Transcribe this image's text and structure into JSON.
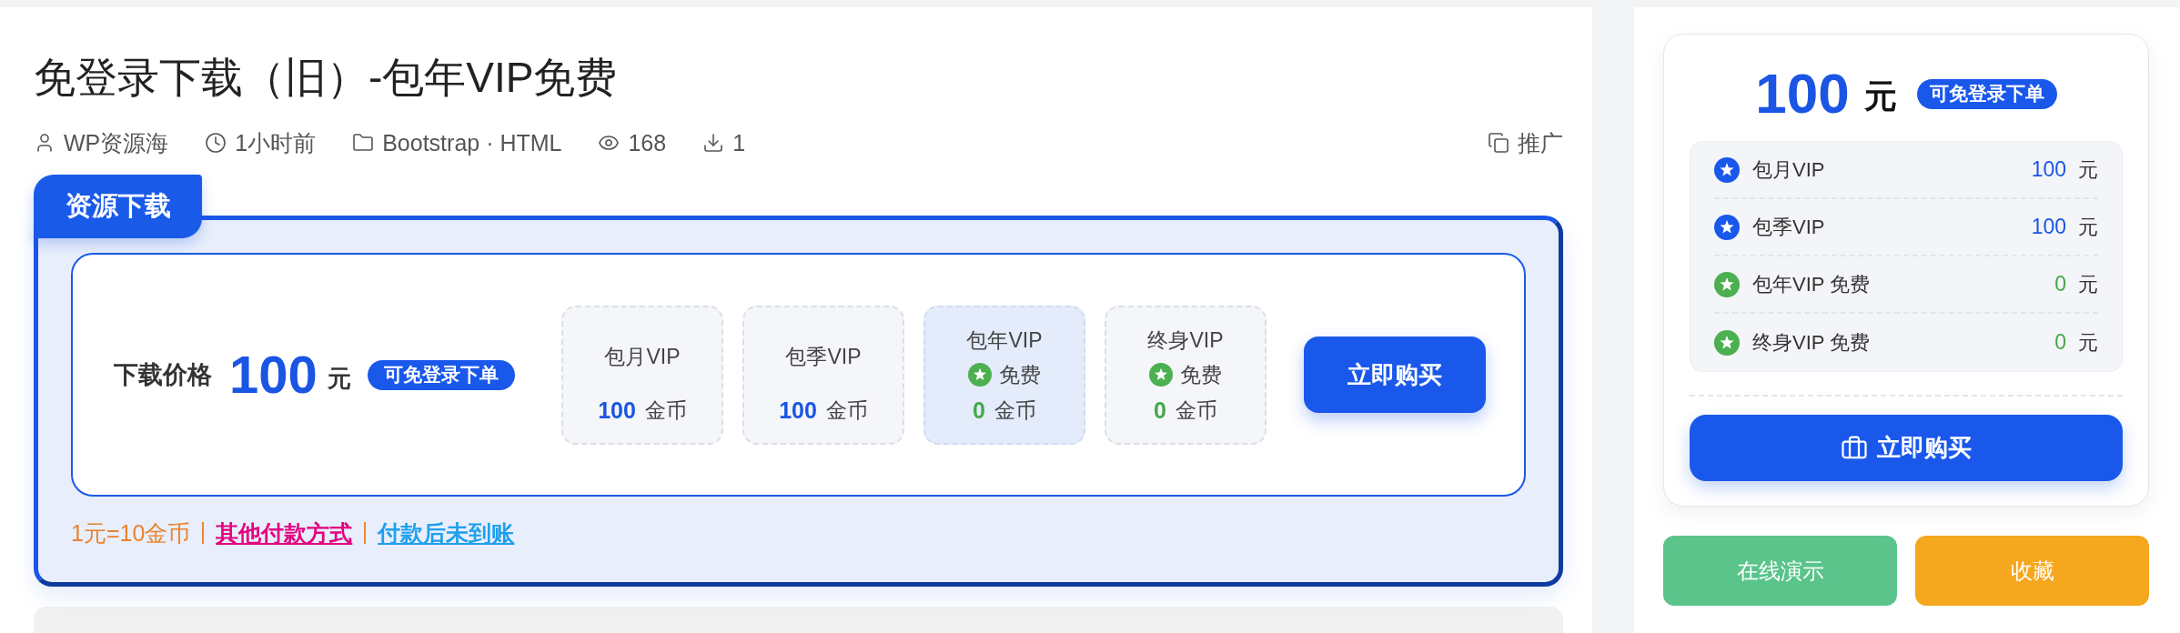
{
  "title": "免登录下载（旧）-包年VIP免费",
  "meta": [
    {
      "kind": "author",
      "text": "WP资源海"
    },
    {
      "kind": "time",
      "text": "1小时前"
    },
    {
      "kind": "category",
      "text": "Bootstrap · HTML"
    },
    {
      "kind": "views",
      "text": "168"
    },
    {
      "kind": "downloads",
      "text": "1"
    }
  ],
  "promote": {
    "label": "推广"
  },
  "download_box": {
    "tab": "资源下载",
    "price_label": "下载价格",
    "price": "100",
    "unit": "元",
    "badge": "可免登录下单",
    "vip_options": [
      {
        "name": "包月VIP",
        "free": false,
        "price": "100",
        "currency": "金币",
        "selected": false
      },
      {
        "name": "包季VIP",
        "free": false,
        "price": "100",
        "currency": "金币",
        "selected": false
      },
      {
        "name": "包年VIP",
        "free": true,
        "free_label": "免费",
        "price": "0",
        "currency": "金币",
        "selected": true
      },
      {
        "name": "终身VIP",
        "free": true,
        "free_label": "免费",
        "price": "0",
        "currency": "金币",
        "selected": false
      }
    ],
    "buy_button": "立即购买",
    "footer": [
      {
        "kind": "note",
        "text": "1元=10金币",
        "color": "#e8832e"
      },
      {
        "kind": "link",
        "text": "其他付款方式",
        "color": "#e4007f"
      },
      {
        "kind": "link",
        "text": "付款后未到账",
        "color": "#1ea0ee"
      }
    ]
  },
  "price_card": {
    "price": "100",
    "unit": "元",
    "badge": "可免登录下单",
    "plans": [
      {
        "name": "包月VIP",
        "free": false,
        "price": "100",
        "unit": "元"
      },
      {
        "name": "包季VIP",
        "free": false,
        "price": "100",
        "unit": "元"
      },
      {
        "name": "包年VIP 免费",
        "free": true,
        "price": "0",
        "unit": "元"
      },
      {
        "name": "终身VIP 免费",
        "free": true,
        "price": "0",
        "unit": "元"
      }
    ],
    "buy_button": "立即购买"
  },
  "actions": [
    {
      "kind": "demo",
      "label": "在线演示"
    },
    {
      "kind": "favorite",
      "label": "收藏"
    }
  ]
}
